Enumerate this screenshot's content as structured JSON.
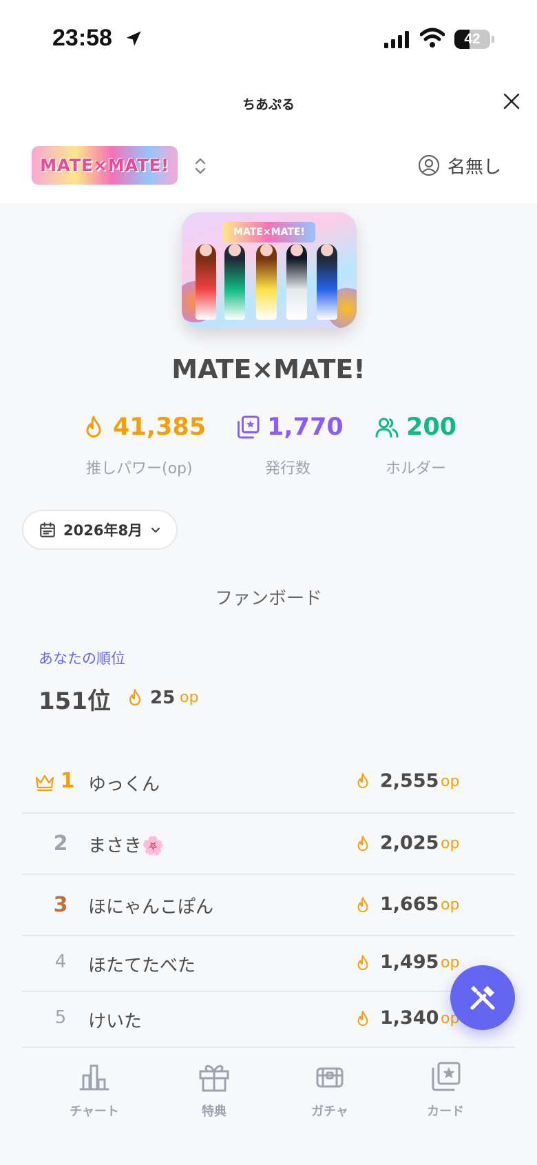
{
  "status_bar": {
    "time": "23:58",
    "battery": "42",
    "battery_level": 0.42
  },
  "title_bar": {
    "title": "ちあぷる"
  },
  "header": {
    "logo_text": "MATE×MATE!",
    "user_name": "名無し"
  },
  "group": {
    "name": "MATE×MATE!"
  },
  "stats": [
    {
      "value": "41,385",
      "label": "推しパワー(op)",
      "color": "#f59e0b",
      "icon": "flame-icon"
    },
    {
      "value": "1,770",
      "label": "発行数",
      "color": "#8b5cf6",
      "icon": "cards-icon"
    },
    {
      "value": "200",
      "label": "ホルダー",
      "color": "#10b981",
      "icon": "users-icon"
    }
  ],
  "month_selector": {
    "label": "2026年8月"
  },
  "fanboard": {
    "title": "ファンボード",
    "my_rank_caption": "あなたの順位",
    "my_rank": "151位",
    "my_op": "25",
    "op_unit": "op",
    "rows": [
      {
        "rank": "1",
        "name": "ゆっくん",
        "op": "2,555",
        "rank_color": "#f59e0b"
      },
      {
        "rank": "2",
        "name": "まさき🌸",
        "op": "2,025",
        "rank_color": "#9ca3af"
      },
      {
        "rank": "3",
        "name": "ほにゃんこぽん",
        "op": "1,665",
        "rank_color": "#c2703a"
      },
      {
        "rank": "4",
        "name": "ほたてたべた",
        "op": "1,495",
        "rank_color": "#9ca3af"
      },
      {
        "rank": "5",
        "name": "けいた",
        "op": "1,340",
        "rank_color": "#9ca3af"
      }
    ]
  },
  "bottom_nav": [
    {
      "label": "チャート",
      "icon": "chart-icon"
    },
    {
      "label": "特典",
      "icon": "gift-icon"
    },
    {
      "label": "ガチャ",
      "icon": "gacha-chest-icon"
    },
    {
      "label": "カード",
      "icon": "card-stack-icon"
    }
  ],
  "colors": {
    "accent": "#6366f1",
    "op": "#f59e0b"
  }
}
